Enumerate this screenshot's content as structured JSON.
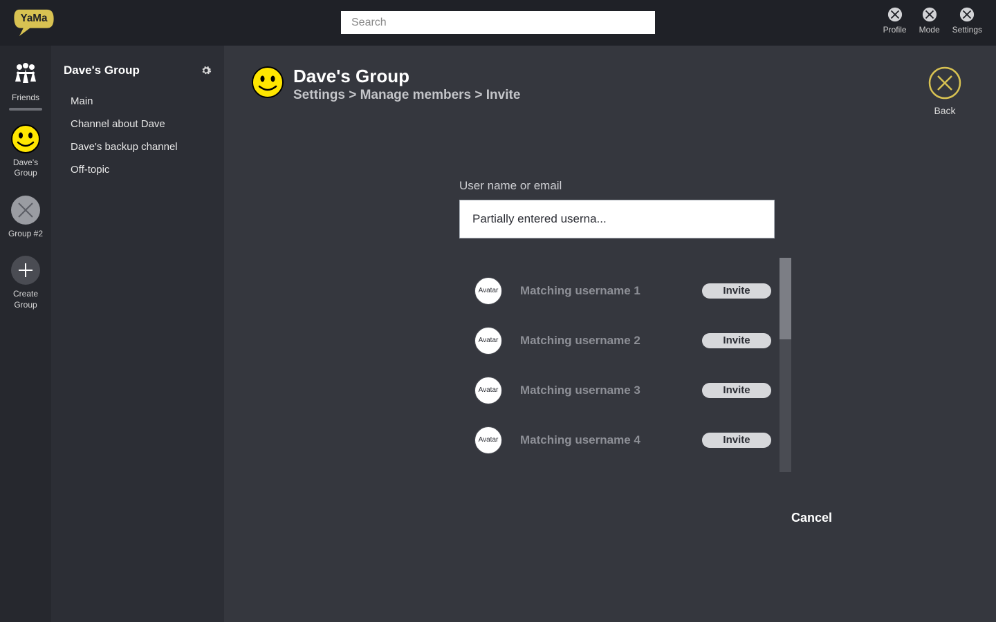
{
  "brand": {
    "name": "YaMa"
  },
  "search": {
    "placeholder": "Search"
  },
  "top_actions": {
    "profile": "Profile",
    "mode": "Mode",
    "settings": "Settings"
  },
  "rail": {
    "friends": "Friends",
    "daves_group": "Dave's Group",
    "group2": "Group #2",
    "create": "Create Group"
  },
  "sidebar": {
    "title": "Dave's Group",
    "channels": [
      "Main",
      "Channel about Dave",
      "Dave's backup channel",
      "Off-topic"
    ]
  },
  "page": {
    "title": "Dave's Group",
    "breadcrumb": "Settings > Manage members > Invite",
    "back_label": "Back"
  },
  "invite": {
    "label": "User name or email",
    "value": "Partially entered userna...",
    "avatar_text": "Avatar",
    "button_label": "Invite",
    "results": [
      {
        "name": "Matching username 1"
      },
      {
        "name": "Matching username 2"
      },
      {
        "name": "Matching username 3"
      },
      {
        "name": "Matching username 4"
      }
    ],
    "cancel": "Cancel"
  },
  "colors": {
    "accent": "#ffe600",
    "accent_stroke": "#d8c252"
  }
}
